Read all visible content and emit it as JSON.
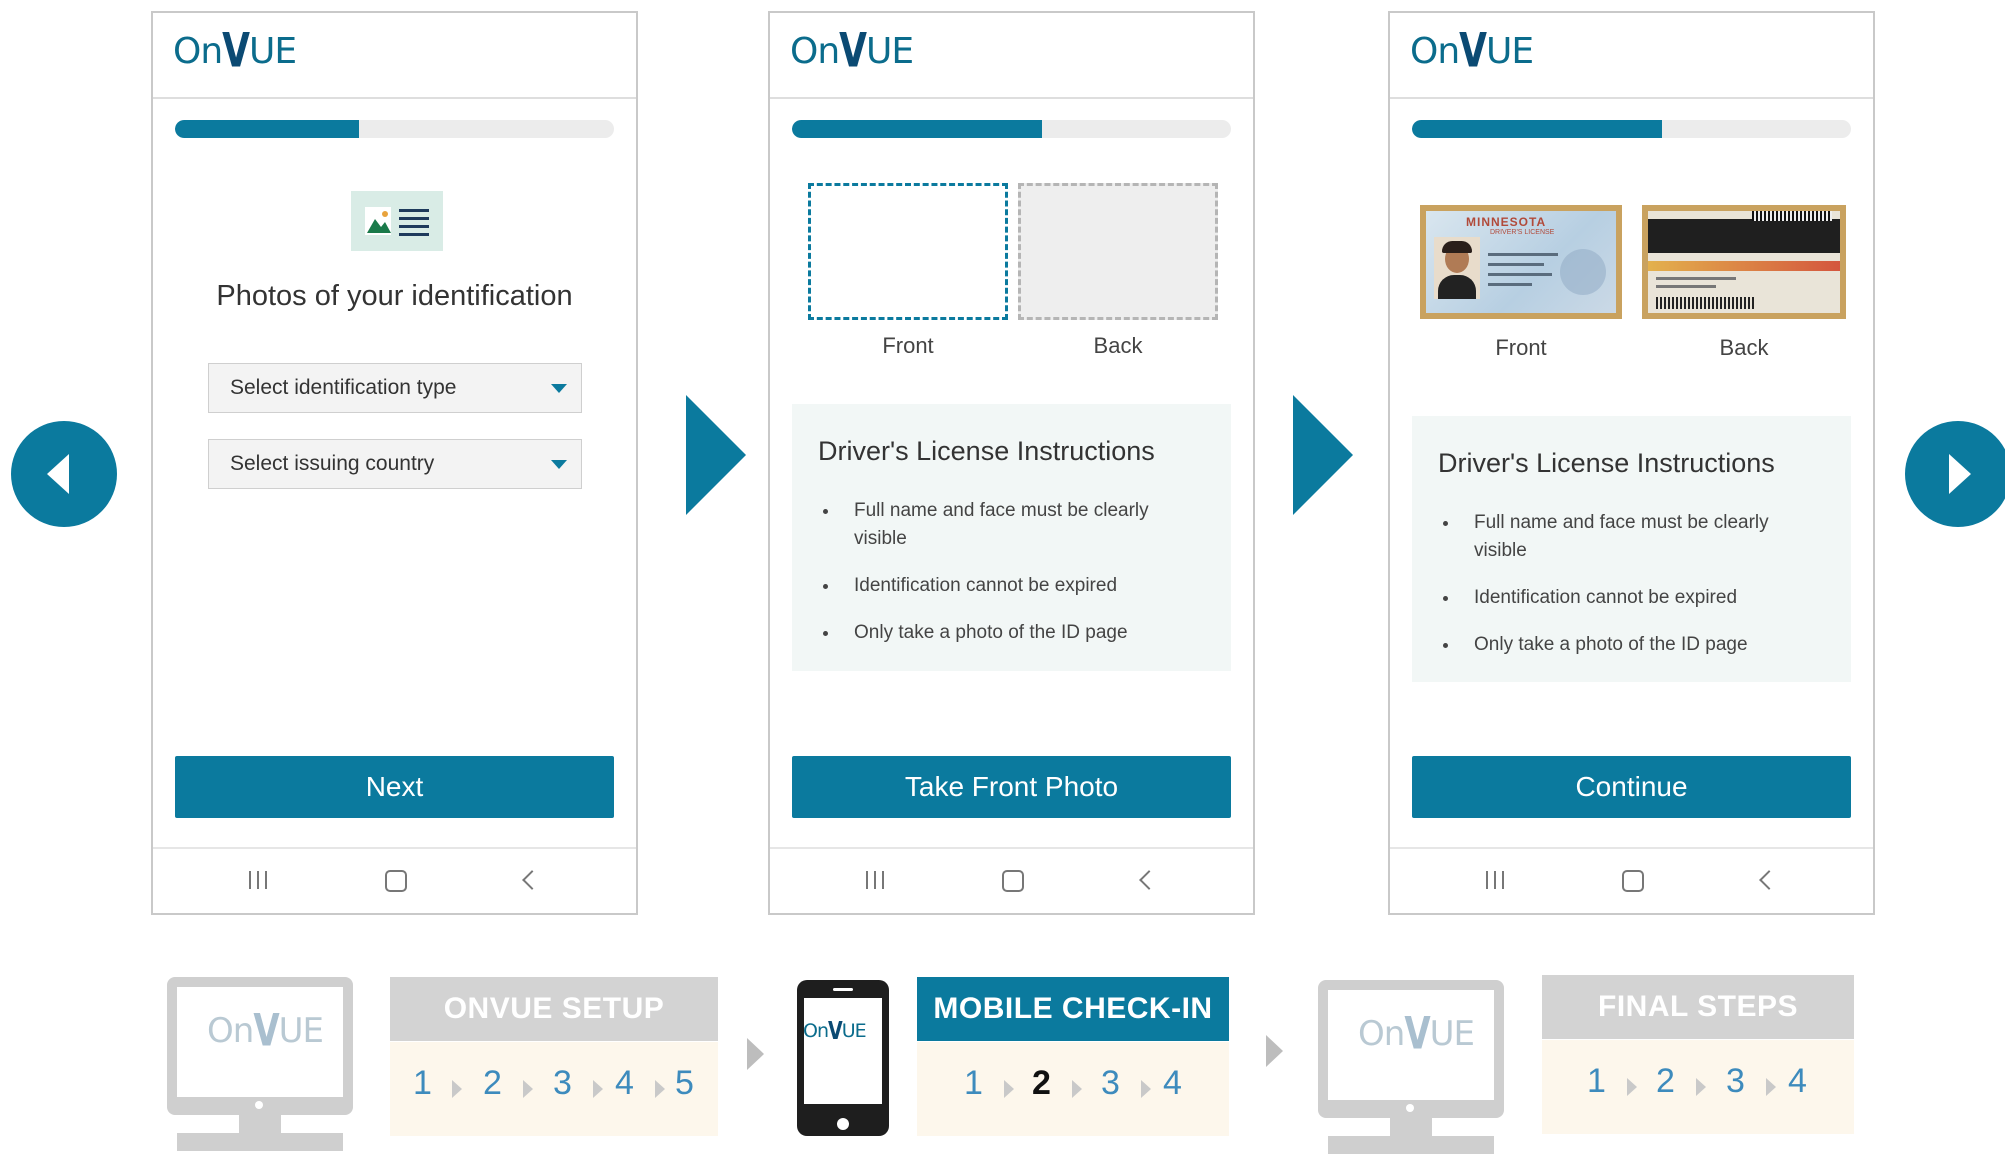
{
  "brand": {
    "logo_prefix": "On",
    "logo_v": "V",
    "logo_suffix": "UE",
    "accent": "#0b7a9e"
  },
  "screen1": {
    "progress": 0.42,
    "title": "Photos of your identification",
    "select_type": "Select identification type",
    "select_country": "Select issuing country",
    "button": "Next"
  },
  "screen2": {
    "progress": 0.57,
    "front_label": "Front",
    "back_label": "Back",
    "instructions_title": "Driver's License Instructions",
    "instructions": [
      "Full name and face must be clearly visible",
      "Identification cannot be expired",
      "Only take a photo of the ID page"
    ],
    "button": "Take Front Photo"
  },
  "screen3": {
    "progress": 0.57,
    "license_state": "MINNESOTA",
    "license_sub": "DRIVER'S LICENSE",
    "front_label": "Front",
    "back_label": "Back",
    "instructions_title": "Driver's License Instructions",
    "instructions": [
      "Full name and face must be clearly visible",
      "Identification cannot be expired",
      "Only take a photo of the ID page"
    ],
    "button": "Continue"
  },
  "workflow": {
    "stage1": {
      "title": "ONVUE SETUP",
      "steps": [
        "1",
        "2",
        "3",
        "4",
        "5"
      ]
    },
    "stage2": {
      "title": "MOBILE CHECK-IN",
      "steps": [
        "1",
        "2",
        "3",
        "4"
      ],
      "active_step": "2"
    },
    "stage3": {
      "title": "FINAL STEPS",
      "steps": [
        "1",
        "2",
        "3",
        "4"
      ]
    }
  }
}
